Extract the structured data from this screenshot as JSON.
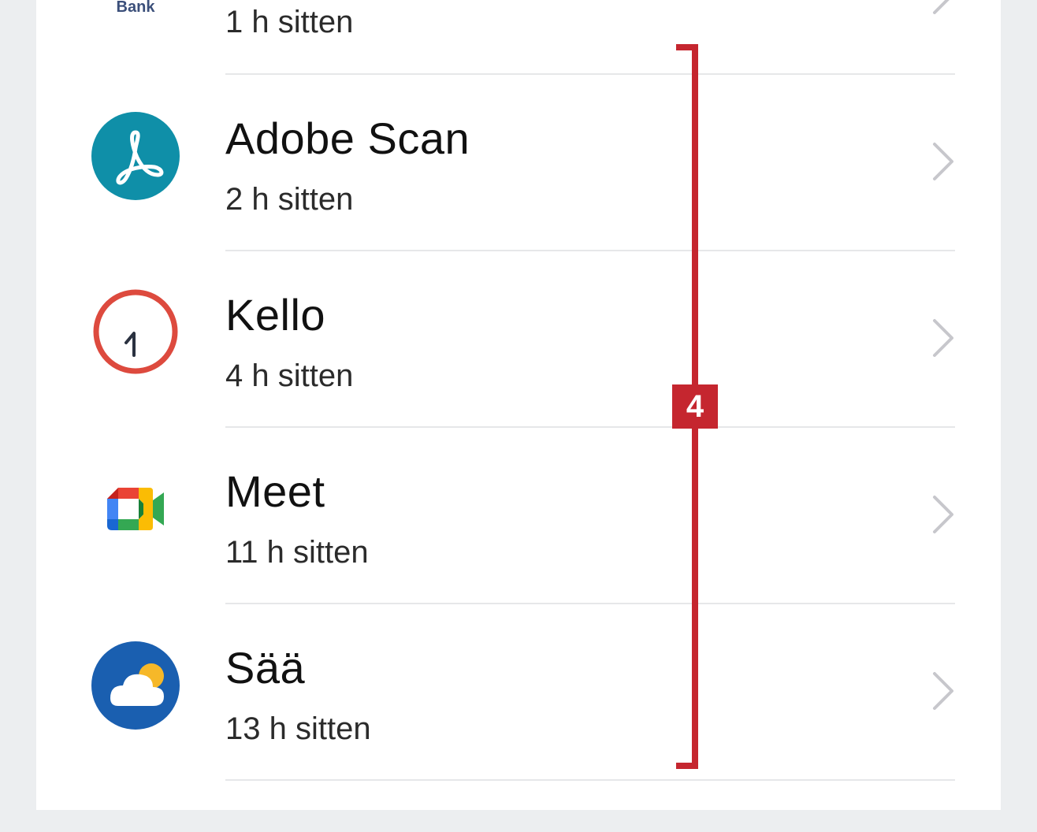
{
  "top_item": {
    "icon_label": "Bank",
    "time": "1 h sitten"
  },
  "items": [
    {
      "name": "Adobe Scan",
      "time": "2 h sitten",
      "icon": "adobe-scan-icon"
    },
    {
      "name": "Kello",
      "time": "4 h sitten",
      "icon": "clock-icon"
    },
    {
      "name": "Meet",
      "time": "11 h sitten",
      "icon": "google-meet-icon"
    },
    {
      "name": "Sää",
      "time": "13 h sitten",
      "icon": "weather-icon"
    }
  ],
  "annotation": {
    "label": "4",
    "color": "#c5262f"
  },
  "colors": {
    "adobe": "#0f8fa8",
    "clock_ring": "#dd4a3e",
    "weather": "#1a5fb0",
    "chevron": "#c7c7cc"
  }
}
